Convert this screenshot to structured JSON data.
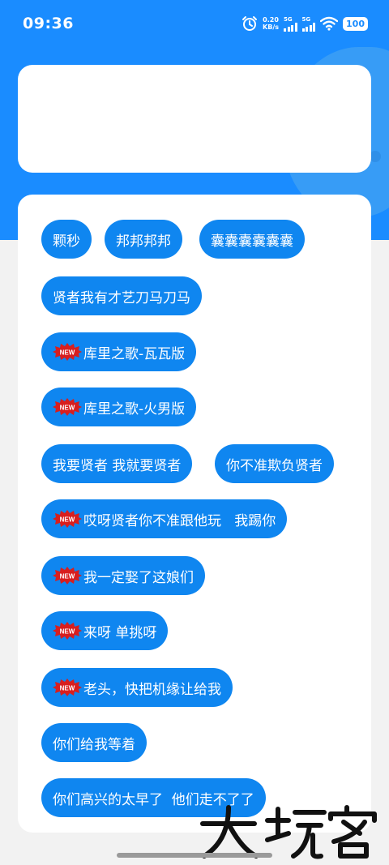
{
  "status_bar": {
    "time": "09:36",
    "net_speed_value": "0.20",
    "net_speed_unit": "KB/s",
    "sim1_label": "5G",
    "sim2_label": "5G",
    "battery": "100"
  },
  "colors": {
    "primary": "#1a8cff",
    "chip": "#0f86f0",
    "background": "#f2f2f2"
  },
  "badge_text": "NEW",
  "watermark_icon": "dawanke-logo",
  "buttons": [
    {
      "label": "颗秒",
      "new": false
    },
    {
      "label": "邦邦邦邦",
      "new": false
    },
    {
      "label": "囊囊囊囊囊囊",
      "new": false
    },
    {
      "label": "贤者我有才艺刀马刀马",
      "new": false
    },
    {
      "label": "库里之歌-瓦瓦版",
      "new": true
    },
    {
      "label": "库里之歌-火男版",
      "new": true
    },
    {
      "label": "我要贤者 我就要贤者",
      "new": false
    },
    {
      "label": "你不准欺负贤者",
      "new": false
    },
    {
      "label": "哎呀贤者你不准跟他玩   我踢你",
      "new": true
    },
    {
      "label": "我一定娶了这娘们",
      "new": true
    },
    {
      "label": "来呀 单挑呀",
      "new": true
    },
    {
      "label": "老头，快把机缘让给我",
      "new": true
    },
    {
      "label": "你们给我等着",
      "new": false
    },
    {
      "label": "你们高兴的太早了  他们走不了了",
      "new": false
    }
  ]
}
